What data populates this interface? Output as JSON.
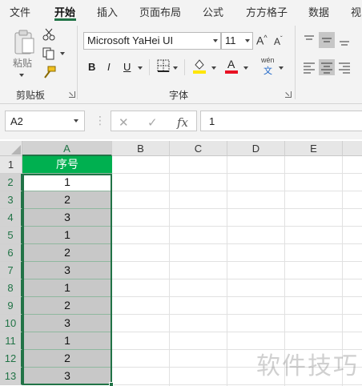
{
  "ribbon_tabs": [
    "文件",
    "开始",
    "插入",
    "页面布局",
    "公式",
    "方方格子",
    "数据",
    "视"
  ],
  "active_tab": "开始",
  "clipboard": {
    "paste_label": "粘贴",
    "group_label": "剪贴板"
  },
  "font": {
    "font_name": "Microsoft YaHei UI",
    "font_size": "11",
    "grow_label": "A",
    "shrink_label": "A",
    "bold": "B",
    "italic": "I",
    "underline": "U",
    "font_color_letter": "A",
    "phonetic_top": "wén",
    "phonetic_bottom": "文",
    "group_label": "字体",
    "highlight_color": "#ffe600",
    "font_color": "#e81123"
  },
  "formula_bar": {
    "name_box": "A2",
    "cancel_icon": "✕",
    "enter_icon": "✓",
    "fx_label": "fx",
    "formula": "1"
  },
  "sheet": {
    "columns": [
      "A",
      "B",
      "C",
      "D",
      "E"
    ],
    "selected_column": "A",
    "row_numbers": [
      "1",
      "2",
      "3",
      "4",
      "5",
      "6",
      "7",
      "8",
      "9",
      "10",
      "11",
      "12",
      "13"
    ],
    "column_a": [
      "序号",
      "1",
      "2",
      "3",
      "1",
      "2",
      "3",
      "1",
      "2",
      "3",
      "1",
      "2",
      "3"
    ],
    "header_fill": "#00b050",
    "selection_color": "#217346"
  },
  "watermark": "软件技巧"
}
